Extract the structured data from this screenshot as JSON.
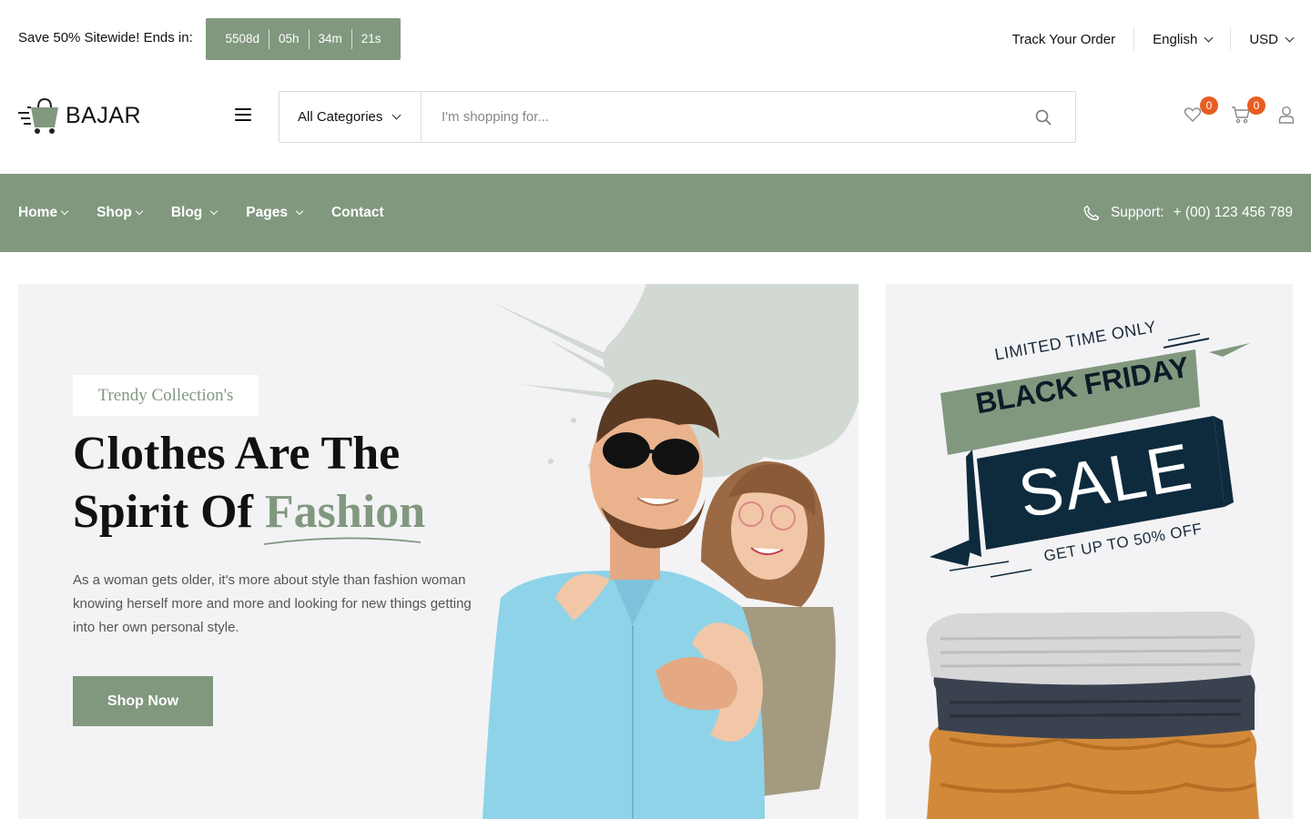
{
  "topbar": {
    "promo_text": "Save 50% Sitewide! Ends in:",
    "countdown": {
      "days": "5508d",
      "hours": "05h",
      "minutes": "34m",
      "seconds": "21s"
    },
    "track_order": "Track Your Order",
    "language": "English",
    "currency": "USD"
  },
  "header": {
    "logo_text": "BAJAR",
    "category_select": "All Categories",
    "search_placeholder": "I'm shopping for...",
    "wishlist_count": "0",
    "cart_count": "0",
    "icons": [
      "menu-icon",
      "chevron-down-icon",
      "search-icon",
      "heart-icon",
      "cart-icon",
      "user-icon"
    ]
  },
  "nav": {
    "items": [
      {
        "label": "Home",
        "dropdown": true
      },
      {
        "label": "Shop",
        "dropdown": true
      },
      {
        "label": "Blog",
        "dropdown": true
      },
      {
        "label": "Pages",
        "dropdown": true
      },
      {
        "label": "Contact",
        "dropdown": false
      }
    ],
    "support_label": "Support:",
    "support_phone": "+ (00) 123 456 789"
  },
  "hero": {
    "tag": "Trendy Collection's",
    "title_line1": "Clothes Are The",
    "title_line2_prefix": "Spirit Of",
    "title_accent": "Fashion",
    "description": "As a woman gets older, it's more about style than fashion woman knowing herself more and more and looking for new things getting into her own personal style.",
    "cta": "Shop Now"
  },
  "banner": {
    "limited": "LIMITED TIME ONLY",
    "headline": "BLACK FRIDAY",
    "sale": "SALE",
    "offer": "GET UP TO 50% OFF"
  },
  "colors": {
    "accent": "#81987f",
    "badge": "#e85d22",
    "navy": "#0e2a3d",
    "hero_bg": "#f3f3f5"
  }
}
